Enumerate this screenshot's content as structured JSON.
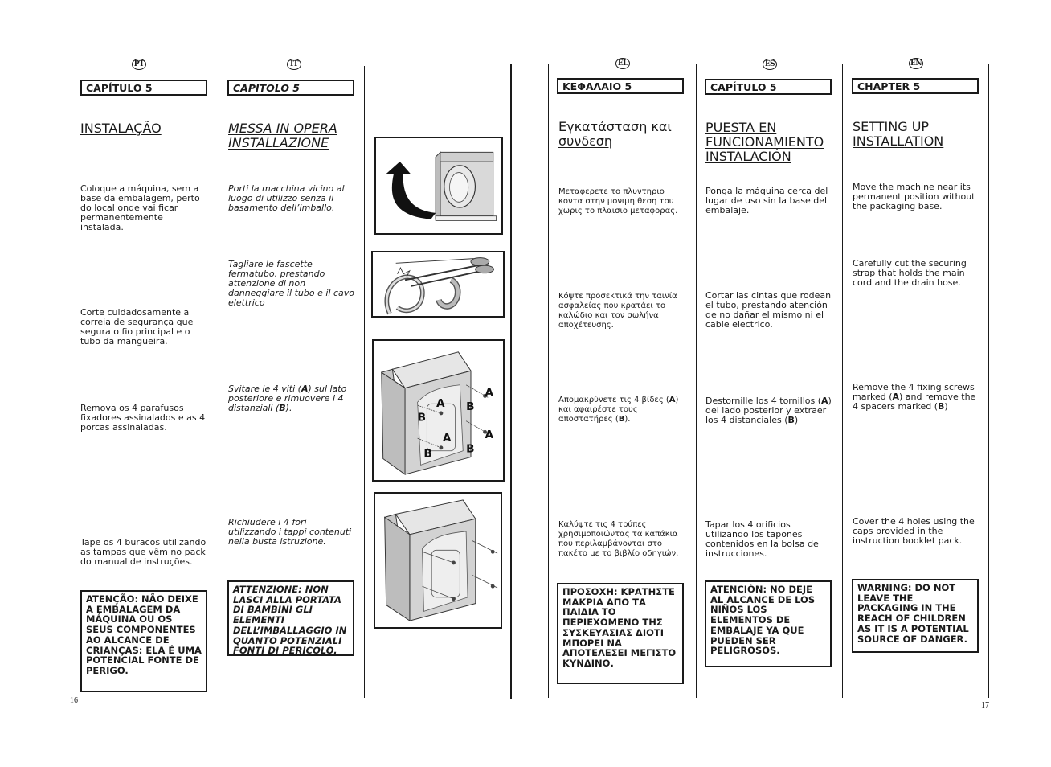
{
  "pages": {
    "left_number": "16",
    "right_number": "17"
  },
  "columns": {
    "pt": {
      "lang_badge": "PT",
      "chapter": "CAPÍTULO 5",
      "title": "INSTALAÇÃO",
      "steps": [
        "Coloque a máquina, sem a base da embalagem, perto do local onde vai ficar permanentemente instalada.",
        "Corte cuidadosamente a correia de segurança que segura o fio principal e o tubo da mangueira.",
        "Remova os 4 parafusos fixadores assinalados e as 4 porcas assinaladas.",
        "Tape os 4 buracos utilizando as tampas que vêm no pack do manual de instruções."
      ],
      "warning": "ATENÇÃO: NÃO DEIXE A EMBALAGEM DA MÁQUINA OU OS SEUS COMPONENTES AO ALCANCE DE CRIANÇAS: ELA É UMA POTENCIAL FONTE DE PERIGO."
    },
    "it": {
      "lang_badge": "IT",
      "chapter": "CAPITOLO 5",
      "title": "MESSA IN OPERA INSTALLAZIONE",
      "steps": [
        "Porti la macchina vicino al luogo di utilizzo senza il basamento dell’imballo.",
        "Tagliare le fascette fermatubo, prestando attenzione di non danneggiare il tubo e il cavo elettrico",
        "Svitare le 4 viti (A) sul lato posteriore e rimuovere i 4 distanziali (B).",
        "Richiudere i 4 fori utilizzando i tappi contenuti nella busta istruzione."
      ],
      "warning": "ATTENZIONE: NON LASCI ALLA PORTATA DI BAMBINI GLI ELEMENTI DELL’IMBALLAGGIO IN QUANTO POTENZIALI FONTI DI PERICOLO."
    },
    "el": {
      "lang_badge": "EL",
      "chapter": "ΚΕΦΑΛΑΙΟ 5",
      "title": "Εγκατάσταση και συνδεση",
      "steps": [
        "Μεταφερετε το πλυντηριο κοντα στην μονιμη θεση του χωρις το πλαισιο μεταφορας.",
        "Κόψτε προσεκτικά την ταινία ασφαλείας που κρατάει το καλώδιο και τον σωλήνα αποχέτευσης.",
        "Απομακρύνετε τις 4 βίδες (A) και αφαιρέστε τους αποστατήρες (B).",
        "Καλύψτε τις 4 τρύπες χρησιμοποιώντας τα καπάκια που περιλαμβάνονται στο πακέτο με το βιβλίο οδηγιών."
      ],
      "warning": "ΠΡΟΣΟΧΗ: ΚΡΑΤΗΣΤΕ ΜΑΚΡΙΑ ΑΠΟ ΤΑ ΠΑΙΔΙΑ ΤΟ ΠΕΡΙΕΧΟΜΕΝΟ ΤΗΣ ΣΥΣΚΕΥΑΣΙΑΣ ΔΙΟΤΙ ΜΠΟΡΕΙ ΝΑ ΑΠΟΤΕΛΕΣΕΙ ΜΕΓΙΣΤΟ ΚΥΝΔΙΝΟ."
    },
    "es": {
      "lang_badge": "ES",
      "chapter": "CAPÍTULO 5",
      "title": "PUESTA EN FUNCIONAMIENTO INSTALACIÓN",
      "steps": [
        "Ponga la máquina cerca del lugar de uso sin la base del embalaje.",
        "Cortar las cintas que rodean el tubo, prestando atención de no dañar el mismo ni el cable electrico.",
        "Destornille los 4 tornillos (A) del lado posterior y extraer los 4 distanciales (B)",
        "Tapar los 4 orificios utilizando los tapones contenidos en la bolsa de instrucciones."
      ],
      "warning": "ATENCIÓN: NO DEJE AL ALCANCE DE LOS NIÑOS LOS ELEMENTOS DE EMBALAJE YA QUE PUEDEN SER PELIGROSOS."
    },
    "en": {
      "lang_badge": "EN",
      "chapter": "CHAPTER 5",
      "title": "SETTING UP INSTALLATION",
      "steps": [
        "Move the machine near its permanent position without the packaging base.",
        "Carefully cut the securing strap that holds the main cord and the drain hose.",
        "Remove the 4 fixing screws marked (A) and remove the 4 spacers marked (B)",
        "Cover the 4 holes using the caps provided in the instruction booklet pack."
      ],
      "warning": "WARNING: DO NOT LEAVE THE PACKAGING IN THE REACH OF CHILDREN AS IT IS A POTENTIAL SOURCE OF DANGER."
    }
  },
  "figures": {
    "fig1": "washing-machine-move-arrow",
    "fig2": "cut-securing-strap-scissors",
    "fig3": {
      "description": "rear-screws-and-spacers",
      "labels": [
        "A",
        "A",
        "A",
        "A",
        "B",
        "B",
        "B",
        "B"
      ]
    },
    "fig4": "cover-holes-caps"
  }
}
